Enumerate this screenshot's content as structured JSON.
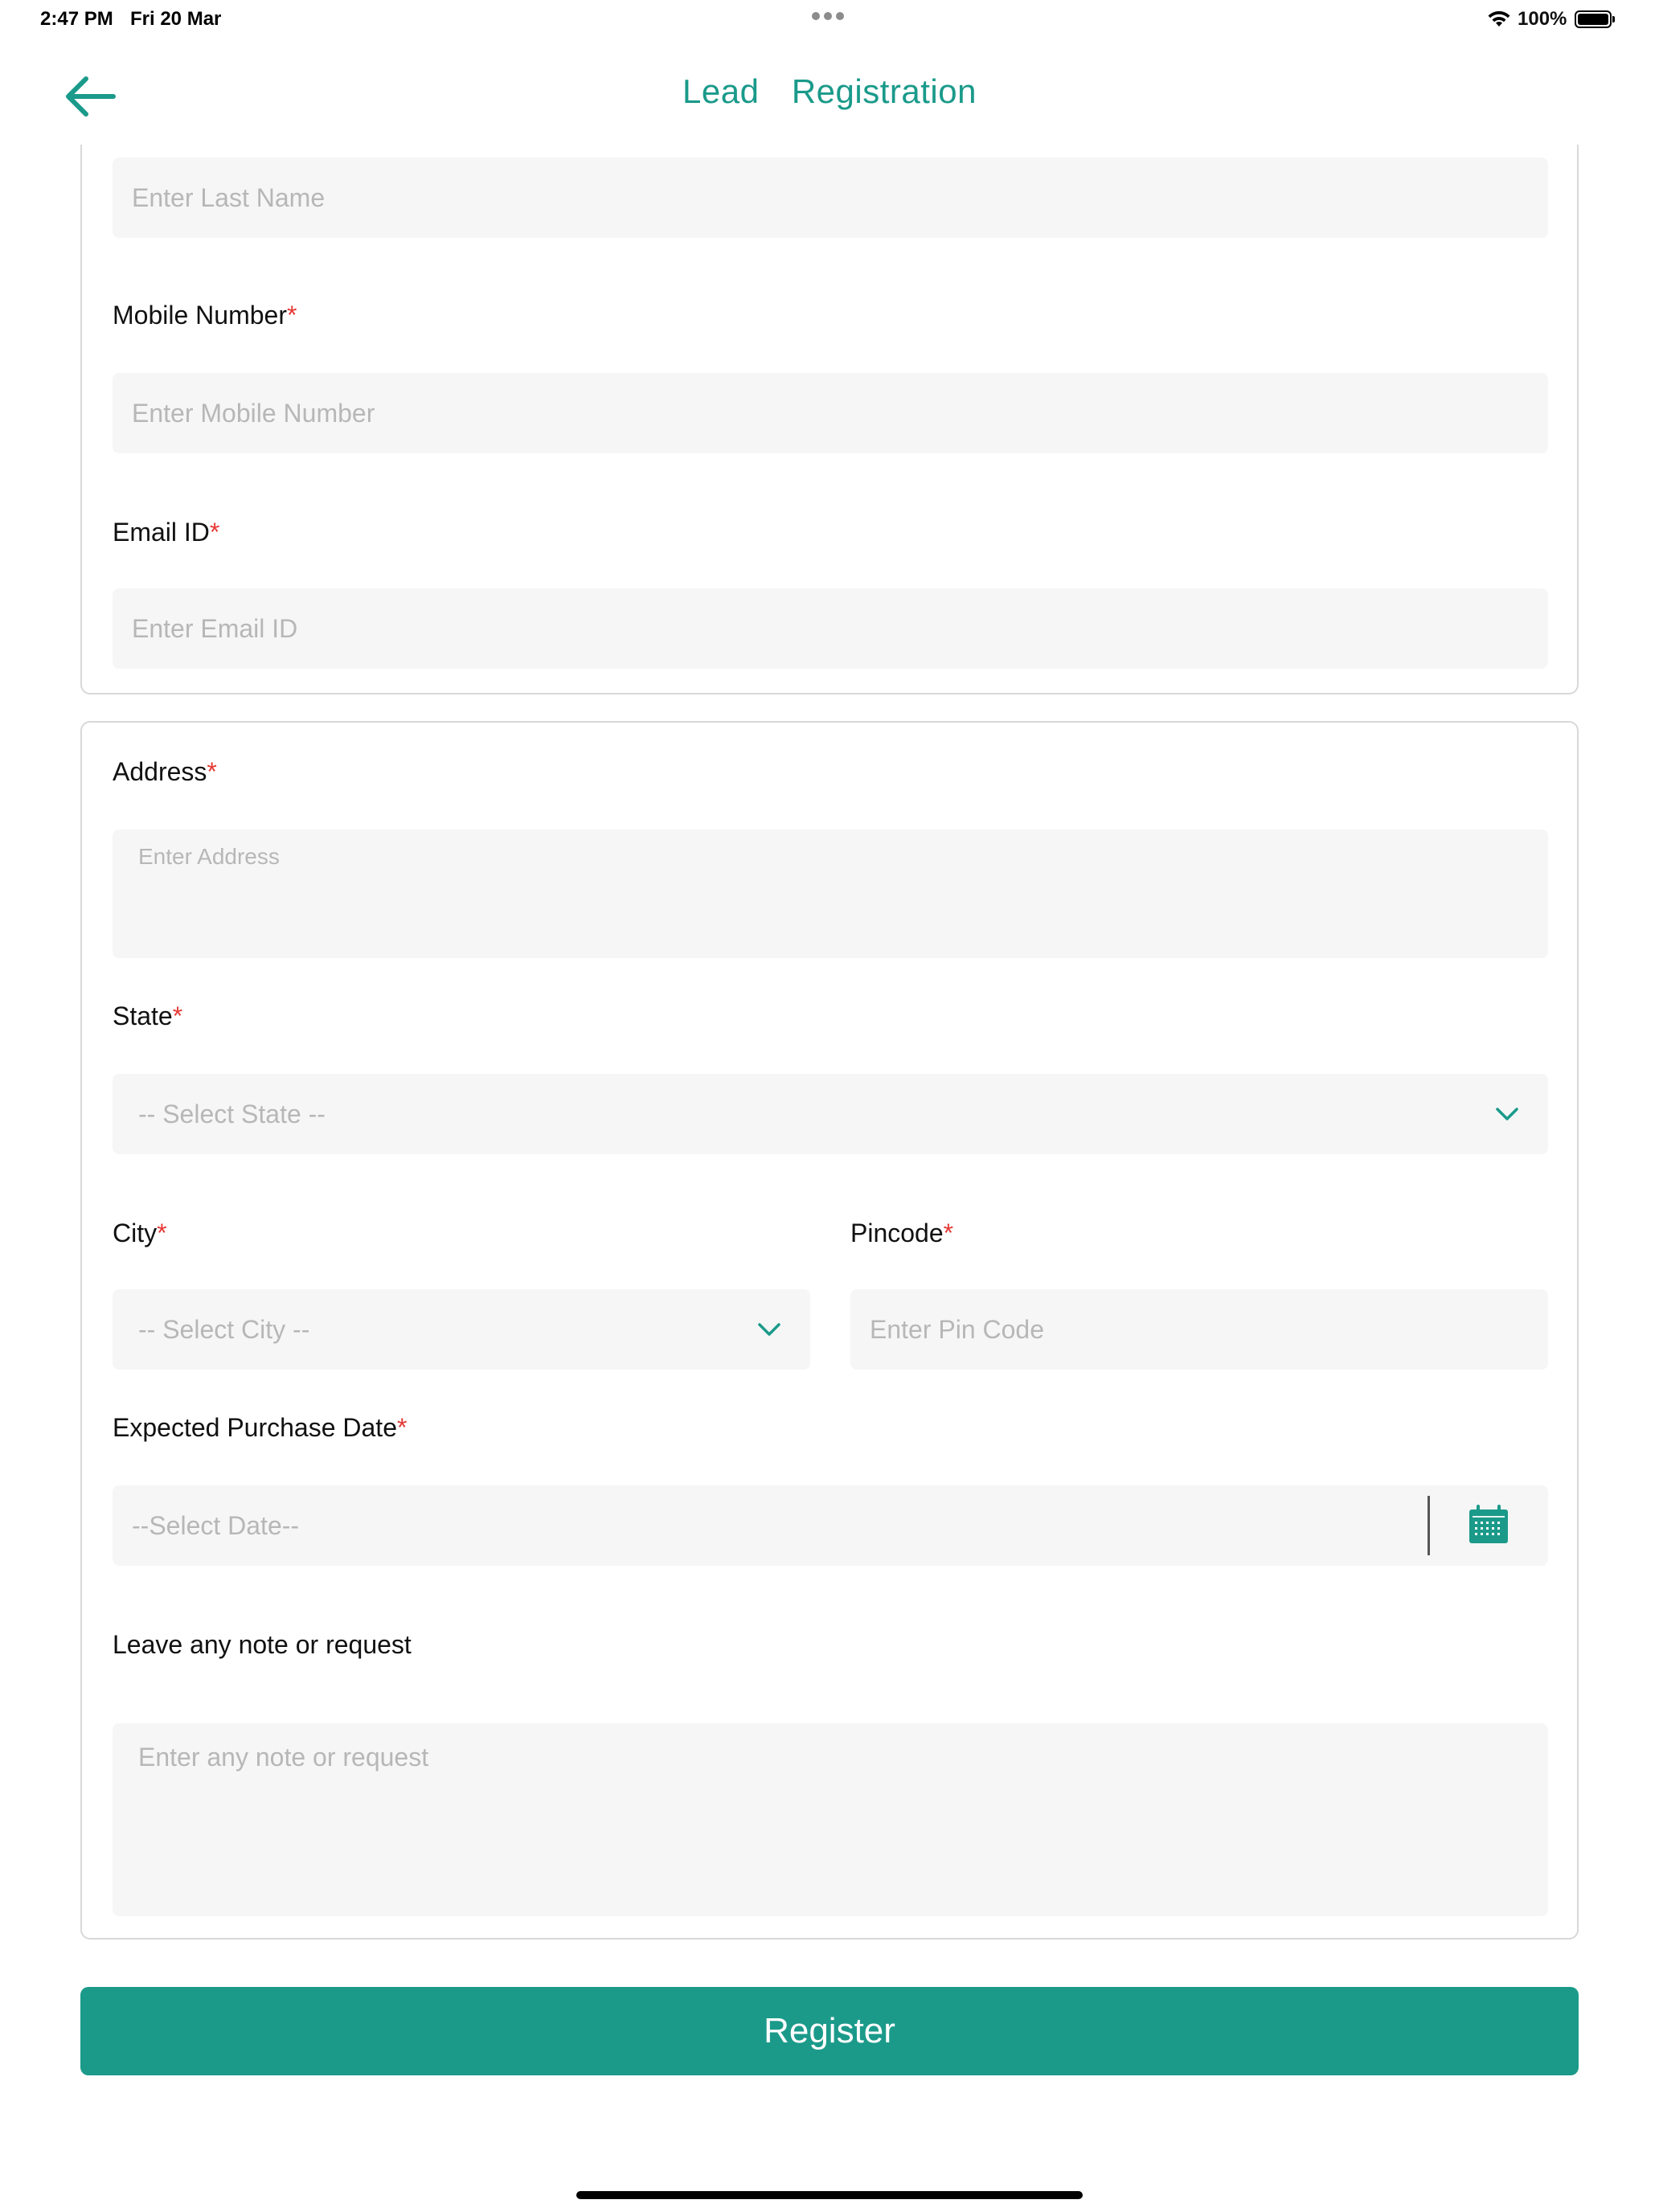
{
  "status_bar": {
    "time": "2:47 PM",
    "date": "Fri 20 Mar",
    "battery": "100%"
  },
  "header": {
    "title": "Lead  Registration"
  },
  "fields": {
    "last_name": {
      "placeholder": "Enter Last Name"
    },
    "mobile": {
      "label": "Mobile Number",
      "required": "*",
      "placeholder": "Enter Mobile Number"
    },
    "email": {
      "label": "Email ID",
      "required": "*",
      "placeholder": "Enter Email ID"
    },
    "address": {
      "label": "Address",
      "required": "*",
      "placeholder": "Enter Address"
    },
    "state": {
      "label": "State",
      "required": "*",
      "selected": "-- Select State --"
    },
    "city": {
      "label": "City",
      "required": "*",
      "selected": "-- Select City --"
    },
    "pincode": {
      "label": "Pincode",
      "required": "*",
      "placeholder": "Enter Pin Code"
    },
    "purchase_date": {
      "label": "Expected Purchase Date",
      "required": "*",
      "placeholder": "--Select Date--"
    },
    "note": {
      "label": "Leave any note or request",
      "placeholder": "Enter any note or request"
    }
  },
  "actions": {
    "register_label": "Register"
  },
  "colors": {
    "accent": "#1b9a8a",
    "required": "#e53935",
    "field_bg": "#f6f6f6",
    "border": "#d8d8d8"
  },
  "icons": {
    "back": "arrow-left-icon",
    "dropdown": "chevron-down-icon",
    "calendar": "calendar-icon",
    "wifi": "wifi-icon",
    "battery": "battery-icon"
  }
}
